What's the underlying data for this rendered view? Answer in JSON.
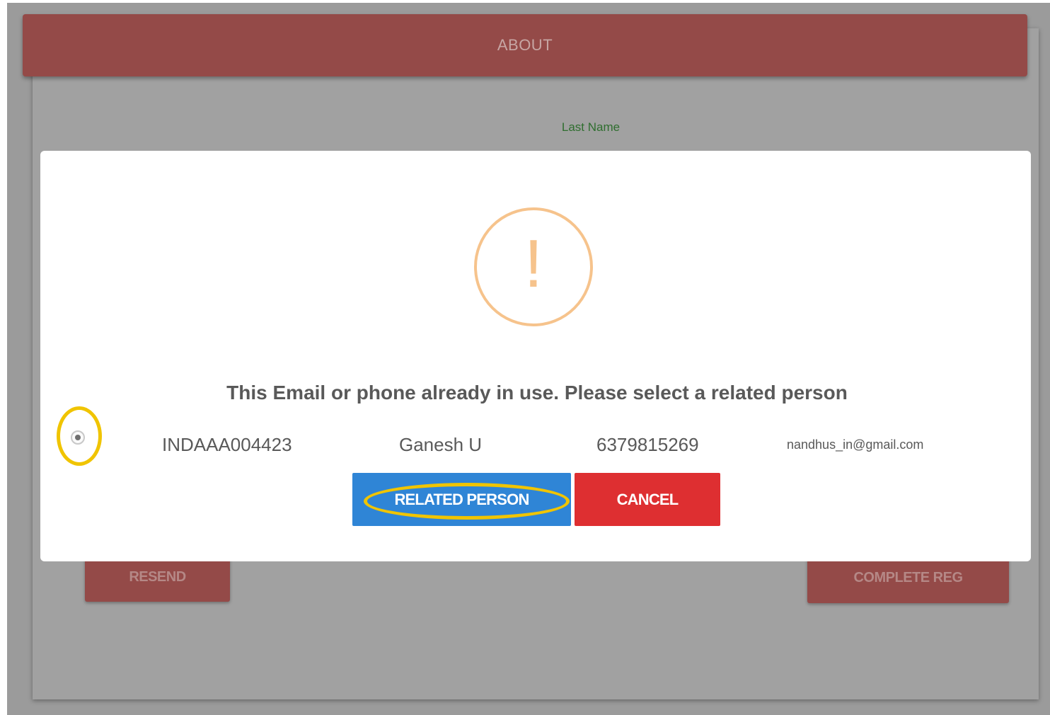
{
  "background": {
    "header_title": "ABOUT",
    "last_name_label": "Last Name",
    "resend_label": "RESEND",
    "complete_label": "COMPLETE REG"
  },
  "modal": {
    "icon": "exclamation-warning-icon",
    "icon_glyph": "!",
    "title": "This Email or phone already in use. Please select a related person",
    "person": {
      "id": "INDAAA004423",
      "name": "Ganesh U",
      "phone": "6379815269",
      "email": "nandhus_in@gmail.com",
      "selected": true
    },
    "related_button": "RELATED PERSON",
    "cancel_button": "CANCEL"
  },
  "colors": {
    "header": "#944a48",
    "warning": "#f6c38c",
    "primary": "#2f85d6",
    "danger": "#de2f31",
    "highlight": "#f0c400"
  }
}
